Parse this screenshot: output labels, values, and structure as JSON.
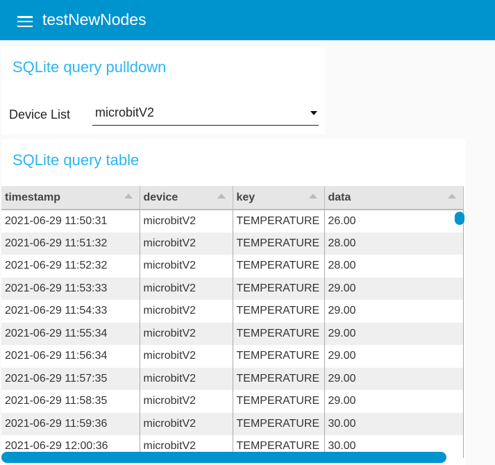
{
  "header": {
    "title": "testNewNodes",
    "menu_icon": "hamburger-icon",
    "color": "#0094ce"
  },
  "pulldown": {
    "title": "SQLite query pulldown",
    "label": "Device List",
    "value": "microbitV2"
  },
  "table_card": {
    "title": "SQLite query table",
    "columns": [
      "timestamp",
      "device",
      "key",
      "data"
    ],
    "rows": [
      [
        "2021-06-29 11:50:31",
        "microbitV2",
        "TEMPERATURE",
        "26.00"
      ],
      [
        "2021-06-29 11:51:32",
        "microbitV2",
        "TEMPERATURE",
        "28.00"
      ],
      [
        "2021-06-29 11:52:32",
        "microbitV2",
        "TEMPERATURE",
        "28.00"
      ],
      [
        "2021-06-29 11:53:33",
        "microbitV2",
        "TEMPERATURE",
        "29.00"
      ],
      [
        "2021-06-29 11:54:33",
        "microbitV2",
        "TEMPERATURE",
        "29.00"
      ],
      [
        "2021-06-29 11:55:34",
        "microbitV2",
        "TEMPERATURE",
        "29.00"
      ],
      [
        "2021-06-29 11:56:34",
        "microbitV2",
        "TEMPERATURE",
        "29.00"
      ],
      [
        "2021-06-29 11:57:35",
        "microbitV2",
        "TEMPERATURE",
        "29.00"
      ],
      [
        "2021-06-29 11:58:35",
        "microbitV2",
        "TEMPERATURE",
        "29.00"
      ],
      [
        "2021-06-29 11:59:36",
        "microbitV2",
        "TEMPERATURE",
        "30.00"
      ],
      [
        "2021-06-29 12:00:36",
        "microbitV2",
        "TEMPERATURE",
        "30.00"
      ]
    ]
  }
}
